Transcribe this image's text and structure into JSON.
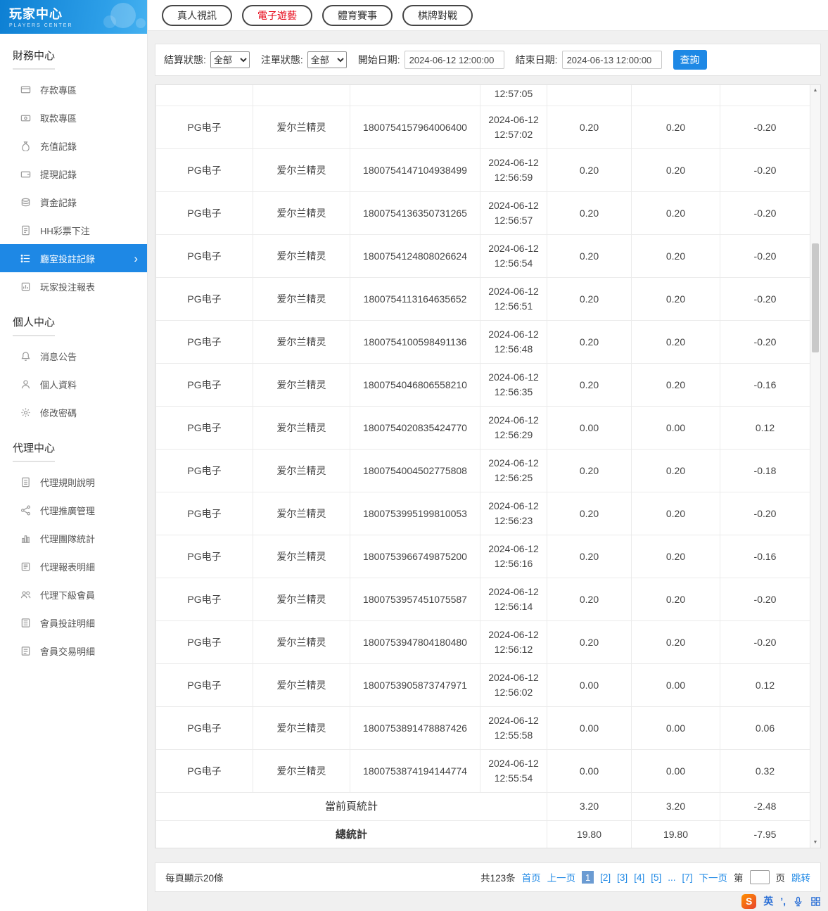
{
  "accent": {
    "primary_blue": "#1e88e5",
    "active_red": "#e60012"
  },
  "sidebar": {
    "logo_title": "玩家中心",
    "logo_subtitle": "PLAYERS CENTER",
    "sections": [
      {
        "title": "財務中心",
        "items": [
          {
            "label": "存款專區",
            "icon": "deposit-icon"
          },
          {
            "label": "取款專區",
            "icon": "withdraw-icon"
          },
          {
            "label": "充值記錄",
            "icon": "recharge-icon"
          },
          {
            "label": "提現記錄",
            "icon": "cashout-icon"
          },
          {
            "label": "資金記錄",
            "icon": "funds-icon"
          },
          {
            "label": "HH彩票下注",
            "icon": "lottery-icon"
          },
          {
            "label": "廳室投註記錄",
            "icon": "bet-record-icon",
            "active": true
          },
          {
            "label": "玩家投注報表",
            "icon": "report-icon"
          }
        ]
      },
      {
        "title": "個人中心",
        "items": [
          {
            "label": "消息公告",
            "icon": "announcement-icon"
          },
          {
            "label": "個人資料",
            "icon": "profile-icon"
          },
          {
            "label": "修改密碼",
            "icon": "password-icon"
          }
        ]
      },
      {
        "title": "代理中心",
        "items": [
          {
            "label": "代理規則說明",
            "icon": "rules-icon"
          },
          {
            "label": "代理推廣管理",
            "icon": "promotion-icon"
          },
          {
            "label": "代理團隊統計",
            "icon": "team-stats-icon"
          },
          {
            "label": "代理報表明細",
            "icon": "report-detail-icon"
          },
          {
            "label": "代理下級會員",
            "icon": "members-icon"
          },
          {
            "label": "會員投註明細",
            "icon": "member-bets-icon"
          },
          {
            "label": "會員交易明細",
            "icon": "member-trans-icon"
          }
        ]
      }
    ]
  },
  "tabs": [
    {
      "label": "真人視訊"
    },
    {
      "label": "電子遊藝",
      "active": true
    },
    {
      "label": "體育賽事"
    },
    {
      "label": "棋牌對戰"
    }
  ],
  "filters": {
    "settle_status_label": "結算狀態:",
    "settle_status_value": "全部",
    "order_status_label": "注單狀態:",
    "order_status_value": "全部",
    "start_label": "開始日期:",
    "start_value": "2024-06-12 12:00:00",
    "end_label": "結束日期:",
    "end_value": "2024-06-13 12:00:00",
    "search_button": "查詢"
  },
  "table": {
    "partial_row_time": "12:57:05",
    "rows": [
      {
        "platform": "PG电子",
        "game": "爱尔兰精灵",
        "order": "1800754157964006400",
        "date": "2024-06-12",
        "time": "12:57:02",
        "bet": "0.20",
        "valid": "0.20",
        "result": "-0.20"
      },
      {
        "platform": "PG电子",
        "game": "爱尔兰精灵",
        "order": "1800754147104938499",
        "date": "2024-06-12",
        "time": "12:56:59",
        "bet": "0.20",
        "valid": "0.20",
        "result": "-0.20"
      },
      {
        "platform": "PG电子",
        "game": "爱尔兰精灵",
        "order": "1800754136350731265",
        "date": "2024-06-12",
        "time": "12:56:57",
        "bet": "0.20",
        "valid": "0.20",
        "result": "-0.20"
      },
      {
        "platform": "PG电子",
        "game": "爱尔兰精灵",
        "order": "1800754124808026624",
        "date": "2024-06-12",
        "time": "12:56:54",
        "bet": "0.20",
        "valid": "0.20",
        "result": "-0.20"
      },
      {
        "platform": "PG电子",
        "game": "爱尔兰精灵",
        "order": "1800754113164635652",
        "date": "2024-06-12",
        "time": "12:56:51",
        "bet": "0.20",
        "valid": "0.20",
        "result": "-0.20"
      },
      {
        "platform": "PG电子",
        "game": "爱尔兰精灵",
        "order": "1800754100598491136",
        "date": "2024-06-12",
        "time": "12:56:48",
        "bet": "0.20",
        "valid": "0.20",
        "result": "-0.20"
      },
      {
        "platform": "PG电子",
        "game": "爱尔兰精灵",
        "order": "1800754046806558210",
        "date": "2024-06-12",
        "time": "12:56:35",
        "bet": "0.20",
        "valid": "0.20",
        "result": "-0.16"
      },
      {
        "platform": "PG电子",
        "game": "爱尔兰精灵",
        "order": "1800754020835424770",
        "date": "2024-06-12",
        "time": "12:56:29",
        "bet": "0.00",
        "valid": "0.00",
        "result": "0.12"
      },
      {
        "platform": "PG电子",
        "game": "爱尔兰精灵",
        "order": "1800754004502775808",
        "date": "2024-06-12",
        "time": "12:56:25",
        "bet": "0.20",
        "valid": "0.20",
        "result": "-0.18"
      },
      {
        "platform": "PG电子",
        "game": "爱尔兰精灵",
        "order": "1800753995199810053",
        "date": "2024-06-12",
        "time": "12:56:23",
        "bet": "0.20",
        "valid": "0.20",
        "result": "-0.20"
      },
      {
        "platform": "PG电子",
        "game": "爱尔兰精灵",
        "order": "1800753966749875200",
        "date": "2024-06-12",
        "time": "12:56:16",
        "bet": "0.20",
        "valid": "0.20",
        "result": "-0.16"
      },
      {
        "platform": "PG电子",
        "game": "爱尔兰精灵",
        "order": "1800753957451075587",
        "date": "2024-06-12",
        "time": "12:56:14",
        "bet": "0.20",
        "valid": "0.20",
        "result": "-0.20"
      },
      {
        "platform": "PG电子",
        "game": "爱尔兰精灵",
        "order": "1800753947804180480",
        "date": "2024-06-12",
        "time": "12:56:12",
        "bet": "0.20",
        "valid": "0.20",
        "result": "-0.20"
      },
      {
        "platform": "PG电子",
        "game": "爱尔兰精灵",
        "order": "1800753905873747971",
        "date": "2024-06-12",
        "time": "12:56:02",
        "bet": "0.00",
        "valid": "0.00",
        "result": "0.12"
      },
      {
        "platform": "PG电子",
        "game": "爱尔兰精灵",
        "order": "1800753891478887426",
        "date": "2024-06-12",
        "time": "12:55:58",
        "bet": "0.00",
        "valid": "0.00",
        "result": "0.06"
      },
      {
        "platform": "PG电子",
        "game": "爱尔兰精灵",
        "order": "1800753874194144774",
        "date": "2024-06-12",
        "time": "12:55:54",
        "bet": "0.00",
        "valid": "0.00",
        "result": "0.32"
      }
    ],
    "page_summary": {
      "label": "當前頁統計",
      "bet": "3.20",
      "valid": "3.20",
      "result": "-2.48"
    },
    "total_summary": {
      "label": "總統計",
      "bet": "19.80",
      "valid": "19.80",
      "result": "-7.95"
    }
  },
  "pagination": {
    "page_size_text": "每頁顯示20條",
    "total_text": "共123条",
    "first": "首页",
    "prev": "上一页",
    "pages": [
      {
        "label": "1",
        "current": true
      },
      {
        "label": "[2]"
      },
      {
        "label": "[3]"
      },
      {
        "label": "[4]"
      },
      {
        "label": "[5]"
      },
      {
        "label": "...",
        "dots": true
      },
      {
        "label": "[7]"
      }
    ],
    "next": "下一页",
    "jump_prefix": "第",
    "jump_suffix": "页",
    "jump_button": "跳转"
  },
  "ime": {
    "logo": "S",
    "lang": "英",
    "punct": "’,"
  }
}
